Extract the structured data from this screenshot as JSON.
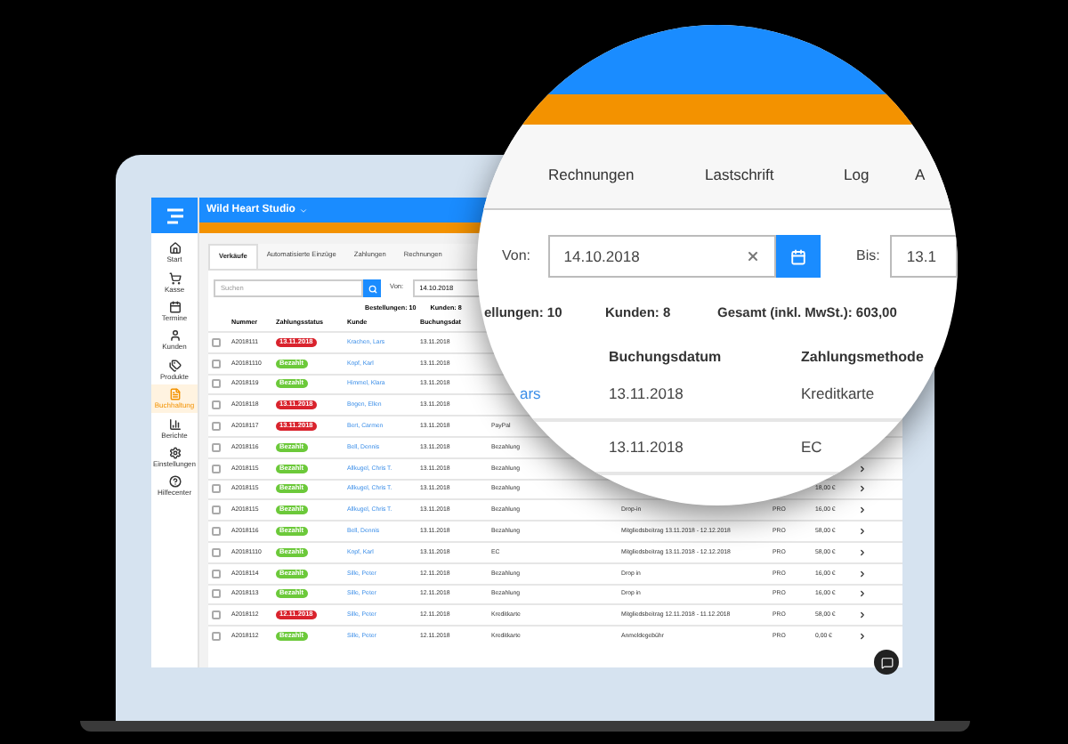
{
  "header": {
    "brand": "Wild Heart Studio"
  },
  "sidebar": {
    "items": [
      {
        "label": "Start",
        "selected": false
      },
      {
        "label": "Kasse",
        "selected": false
      },
      {
        "label": "Termine",
        "selected": false
      },
      {
        "label": "Kunden",
        "selected": false
      },
      {
        "label": "Produkte",
        "selected": false
      },
      {
        "label": "Buchhaltung",
        "selected": true
      },
      {
        "label": "Berichte",
        "selected": false
      },
      {
        "label": "Einstellungen",
        "selected": false
      },
      {
        "label": "Hilfecenter",
        "selected": false
      }
    ]
  },
  "tabs": [
    {
      "label": "Verkäufe",
      "selected": true
    },
    {
      "label": "Automatisierte Einzüge",
      "selected": false
    },
    {
      "label": "Zahlungen",
      "selected": false
    },
    {
      "label": "Rechnungen",
      "selected": false
    }
  ],
  "search": {
    "placeholder": "Suchen"
  },
  "date_from": {
    "label": "Von:",
    "value": "14.10.2018"
  },
  "stats": [
    "Bestellungen: 10",
    "Kunden: 8"
  ],
  "table": {
    "columns": [
      "Nummer",
      "Zahlungsstatus",
      "Kunde",
      "Buchungsdat"
    ],
    "rows": [
      {
        "checked": false,
        "number": "A2018111",
        "kind": "due",
        "status_label": "13.11.2018",
        "customer": "Krachen, Lars",
        "date": "13.11.2018"
      },
      {
        "checked": false,
        "number": "A20181110",
        "kind": "paid",
        "status_label": "Bezahlt",
        "customer": "Kopf, Karl",
        "date": "13.11.2018"
      },
      {
        "checked": false,
        "number": "A2018119",
        "kind": "paid",
        "status_label": "Bezahlt",
        "customer": "Himmel, Klara",
        "date": "13.11.2018"
      },
      {
        "checked": false,
        "number": "A2018118",
        "kind": "due",
        "status_label": "13.11.2018",
        "customer": "Bogen, Ellen",
        "date": "13.11.2018"
      },
      {
        "checked": false,
        "number": "A2018117",
        "kind": "due",
        "status_label": "13.11.2018",
        "customer": "Bert, Carmen",
        "date": "13.11.2018",
        "method": "PayPal"
      },
      {
        "checked": false,
        "number": "A2018116",
        "kind": "paid",
        "status_label": "Bezahlt",
        "customer": "Bell, Dennis",
        "date": "13.11.2018",
        "method": "Bezahlung"
      },
      {
        "checked": false,
        "number": "A2018115",
        "kind": "paid",
        "status_label": "Bezahlt",
        "customer": "Allkugel, Chris T.",
        "date": "13.11.2018",
        "method": "Bezahlung"
      },
      {
        "checked": false,
        "number": "A2018115",
        "kind": "paid",
        "status_label": "Bezahlt",
        "customer": "Allkugel, Chris T.",
        "date": "13.11.2018",
        "method": "Bezahlung",
        "amount": "18,00 €"
      },
      {
        "checked": false,
        "number": "A2018115",
        "kind": "paid",
        "status_label": "Bezahlt",
        "customer": "Allkugel, Chris T.",
        "date": "13.11.2018",
        "method": "Bezahlung",
        "description": "Drop-in",
        "plan": "PRO",
        "amount": "16,00 €"
      },
      {
        "checked": false,
        "number": "A2018116",
        "kind": "paid",
        "status_label": "Bezahlt",
        "customer": "Bell, Dennis",
        "date": "13.11.2018",
        "method": "Bezahlung",
        "description": "Mitgliedsbeitrag 13.11.2018 - 12.12.2018",
        "plan": "PRO",
        "amount": "58,00 €"
      },
      {
        "checked": false,
        "number": "A20181110",
        "kind": "paid",
        "status_label": "Bezahlt",
        "customer": "Kopf, Karl",
        "date": "13.11.2018",
        "method": "EC",
        "description": "Mitgliedsbeitrag 13.11.2018 - 12.12.2018",
        "plan": "PRO",
        "amount": "58,00 €"
      },
      {
        "checked": false,
        "number": "A2018114",
        "kind": "paid",
        "status_label": "Bezahlt",
        "customer": "Sille, Peter",
        "date": "12.11.2018",
        "method": "Bezahlung",
        "description": "Drop in",
        "plan": "PRO",
        "amount": "16,00 €"
      },
      {
        "checked": false,
        "number": "A2018113",
        "kind": "paid",
        "status_label": "Bezahlt",
        "customer": "Sille, Peter",
        "date": "12.11.2018",
        "method": "Bezahlung",
        "description": "Drop in",
        "plan": "PRO",
        "amount": "16,00 €"
      },
      {
        "checked": false,
        "number": "A2018112",
        "kind": "due",
        "status_label": "12.11.2018",
        "customer": "Sille, Peter",
        "date": "12.11.2018",
        "method": "Kreditkarte",
        "description": "Mitgliedsbeitrag 12.11.2018 - 11.12.2018",
        "plan": "PRO",
        "amount": "58,00 €"
      },
      {
        "checked": false,
        "number": "A2018112",
        "kind": "paid",
        "status_label": "Bezahlt",
        "customer": "Sille, Peter",
        "date": "12.11.2018",
        "method": "Kreditkarte",
        "description": "Anmeldegebühr",
        "plan": "PRO",
        "amount": "0,00 €"
      }
    ]
  },
  "magnifier": {
    "tabs": [
      "Rechnungen",
      "Lastschrift",
      "Log",
      "A"
    ],
    "date_from": {
      "label": "Von:",
      "value": "14.10.2018"
    },
    "date_to": {
      "label": "Bis:",
      "value": "13.1"
    },
    "stats": [
      "ellungen: 10",
      "Kunden: 8",
      "Gesamt (inkl. MwSt.): 603,00"
    ],
    "columns": [
      "Buchungsdatum",
      "Zahlungsmethode"
    ],
    "rows": [
      {
        "customer": "ars",
        "date": "13.11.2018",
        "method": "Kreditkarte"
      },
      {
        "date": "13.11.2018",
        "method": "EC"
      }
    ]
  }
}
